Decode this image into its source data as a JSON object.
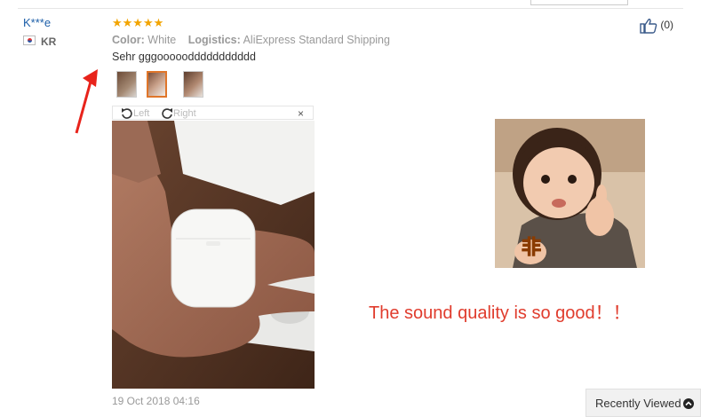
{
  "reviewer": {
    "name": "K***e",
    "country": "KR"
  },
  "rating": {
    "stars_text": "★★★★★",
    "value": 5,
    "max": 5
  },
  "meta": {
    "color_label": "Color:",
    "color_value": "White",
    "logistics_label": "Logistics:",
    "logistics_value": "AliExpress Standard Shipping"
  },
  "review": {
    "text": "Sehr gggoooooddddddddddd",
    "date": "19 Oct 2018 04:16"
  },
  "helpful": {
    "count": "(0)"
  },
  "viewer": {
    "rotate_left": "Left",
    "rotate_right": "Right",
    "close": "×"
  },
  "caption": "The sound quality is so good！！",
  "recently_viewed": {
    "label": "Recently Viewed"
  },
  "colors": {
    "link": "#1c5ea8",
    "star": "#f2a400",
    "caption": "#e03c2d",
    "arrow": "#e8231b"
  }
}
